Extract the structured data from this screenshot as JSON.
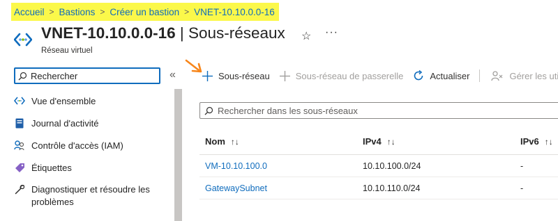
{
  "breadcrumb": [
    "Accueil",
    "Bastions",
    "Créer un bastion",
    "VNET-10.10.0.0-16"
  ],
  "header": {
    "title_main": "VNET-10.10.0.0-16",
    "title_sep": " | ",
    "title_section": "Sous-réseaux",
    "subtitle": "Réseau virtuel",
    "more": "···"
  },
  "nav": {
    "search_placeholder": "Rechercher",
    "collapse": "«",
    "items": [
      {
        "label": "Vue d'ensemble",
        "icon": "vnet-icon"
      },
      {
        "label": "Journal d'activité",
        "icon": "activity-log-icon"
      },
      {
        "label": "Contrôle d'accès (IAM)",
        "icon": "access-control-icon"
      },
      {
        "label": "Étiquettes",
        "icon": "tag-icon"
      },
      {
        "label": "Diagnostiquer et résoudre les problèmes",
        "icon": "wrench-icon"
      }
    ]
  },
  "toolbar": {
    "add_subnet": "Sous-réseau",
    "add_gateway_subnet": "Sous-réseau de passerelle",
    "refresh": "Actualiser",
    "manage_users": "Gérer les util"
  },
  "subnets": {
    "search_placeholder": "Rechercher dans les sous-réseaux",
    "columns": [
      "Nom",
      "IPv4",
      "IPv6"
    ],
    "sort_glyph": "↑↓",
    "rows": [
      {
        "name": "VM-10.10.100.0",
        "ipv4": "10.10.100.0/24",
        "ipv6": "-"
      },
      {
        "name": "GatewaySubnet",
        "ipv4": "10.10.110.0/24",
        "ipv6": "-"
      }
    ]
  },
  "colors": {
    "accent": "#0f6cbd",
    "breadcrumb_highlight": "#fbf84a",
    "arrow": "#f7861b"
  }
}
